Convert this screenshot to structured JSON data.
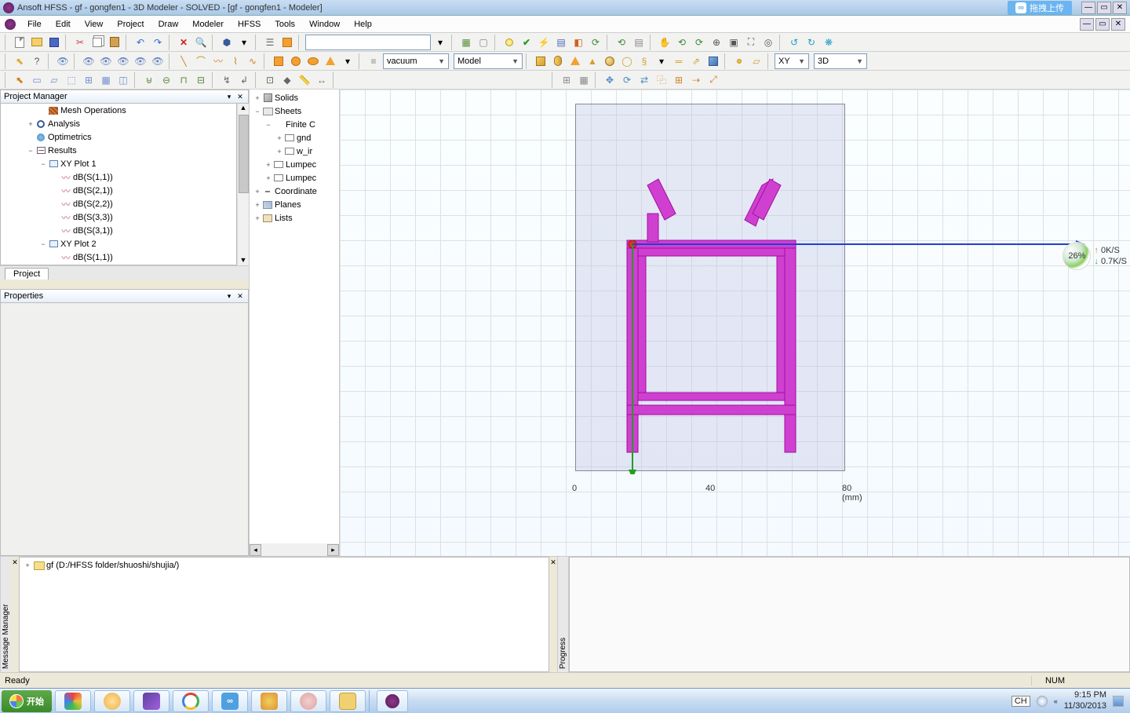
{
  "window": {
    "title": "Ansoft HFSS  - gf - gongfen1 - 3D Modeler - SOLVED - [gf - gongfen1 - Modeler]",
    "upload_widget": "拖拽上传"
  },
  "menubar": [
    "File",
    "Edit",
    "View",
    "Project",
    "Draw",
    "Modeler",
    "HFSS",
    "Tools",
    "Window",
    "Help"
  ],
  "toolbars": {
    "material_dropdown": "vacuum",
    "model_dropdown": "Model",
    "plane_dropdown": "XY",
    "view_dropdown": "3D"
  },
  "panels": {
    "project_manager": {
      "title": "Project Manager",
      "tab": "Project",
      "tree": [
        {
          "indent": 3,
          "expander": "",
          "icon": "i-node-mesh",
          "label": "Mesh Operations"
        },
        {
          "indent": 2,
          "expander": "+",
          "icon": "i-node-analysis",
          "label": "Analysis"
        },
        {
          "indent": 2,
          "expander": "",
          "icon": "i-node-opt",
          "label": "Optimetrics"
        },
        {
          "indent": 2,
          "expander": "−",
          "icon": "i-node-results",
          "label": "Results"
        },
        {
          "indent": 3,
          "expander": "−",
          "icon": "i-node-plot",
          "label": "XY Plot 1"
        },
        {
          "indent": 4,
          "expander": "",
          "icon": "i-node-trace",
          "label": "dB(S(1,1))"
        },
        {
          "indent": 4,
          "expander": "",
          "icon": "i-node-trace",
          "label": "dB(S(2,1))"
        },
        {
          "indent": 4,
          "expander": "",
          "icon": "i-node-trace",
          "label": "dB(S(2,2))"
        },
        {
          "indent": 4,
          "expander": "",
          "icon": "i-node-trace",
          "label": "dB(S(3,3))"
        },
        {
          "indent": 4,
          "expander": "",
          "icon": "i-node-trace",
          "label": "dB(S(3,1))"
        },
        {
          "indent": 3,
          "expander": "−",
          "icon": "i-node-plot",
          "label": "XY Plot 2"
        },
        {
          "indent": 4,
          "expander": "",
          "icon": "i-node-trace",
          "label": "dB(S(1,1))"
        }
      ]
    },
    "properties": {
      "title": "Properties"
    },
    "model_tree": [
      {
        "indent": 0,
        "expander": "+",
        "icon": "i-node-solids",
        "label": "Solids"
      },
      {
        "indent": 0,
        "expander": "−",
        "icon": "i-node-sheets",
        "label": "Sheets"
      },
      {
        "indent": 1,
        "expander": "−",
        "icon": "",
        "label": "Finite C"
      },
      {
        "indent": 2,
        "expander": "+",
        "icon": "i-node-rect",
        "label": "gnd"
      },
      {
        "indent": 2,
        "expander": "+",
        "icon": "i-node-rect",
        "label": "w_ir"
      },
      {
        "indent": 1,
        "expander": "+",
        "icon": "i-node-rect",
        "label": "Lumpec"
      },
      {
        "indent": 1,
        "expander": "+",
        "icon": "i-node-rect",
        "label": "Lumpec"
      },
      {
        "indent": 0,
        "expander": "+",
        "icon": "i-node-coord",
        "label": "Coordinate"
      },
      {
        "indent": 0,
        "expander": "+",
        "icon": "i-node-planes",
        "label": "Planes"
      },
      {
        "indent": 0,
        "expander": "+",
        "icon": "i-node-lists",
        "label": "Lists"
      }
    ]
  },
  "viewport": {
    "ruler": {
      "ticks": [
        "0",
        "40",
        "80"
      ],
      "unit": "(mm)"
    },
    "network": {
      "percent": "26%",
      "up": "0K/S",
      "down": "0.7K/S"
    }
  },
  "message_manager": {
    "side_label": "Message Manager",
    "entry": "gf (D:/HFSS folder/shuoshi/shujia/)"
  },
  "progress": {
    "side_label": "Progress"
  },
  "statusbar": {
    "text": "Ready",
    "kbd": "NUM"
  },
  "taskbar": {
    "start": "开始",
    "lang": "CH",
    "time": "9:15 PM",
    "date": "11/30/2013"
  }
}
